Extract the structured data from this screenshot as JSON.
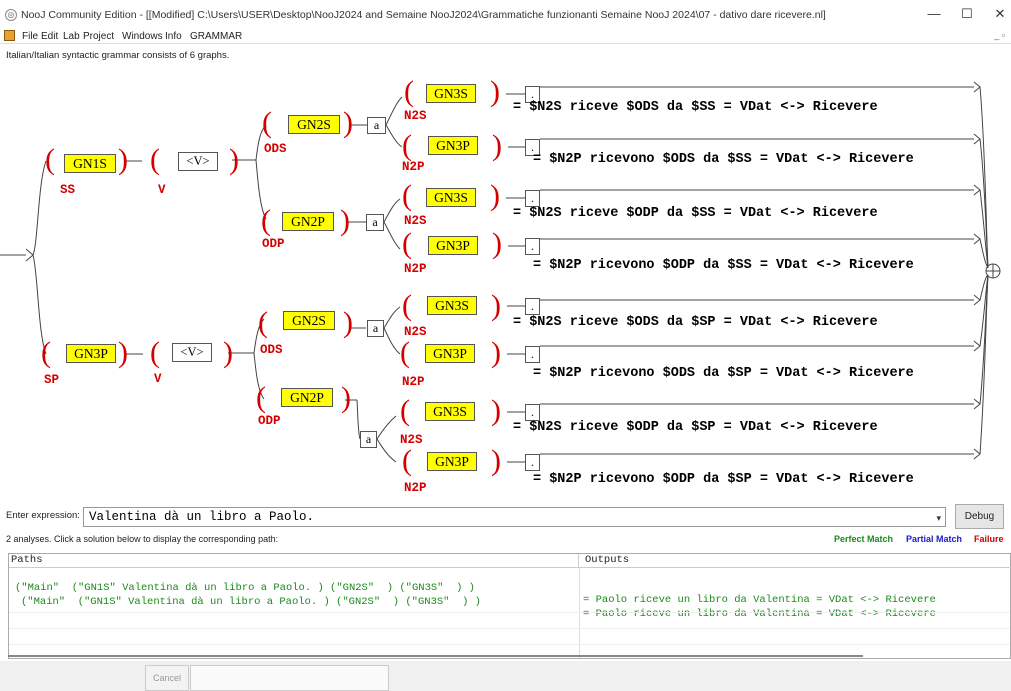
{
  "window": {
    "title": "NooJ Community Edition - [[Modified] C:\\Users\\USER\\Desktop\\NooJ2024 and Semaine NooJ2024\\Grammatiche funzionanti Semaine NooJ 2024\\07 - dativo dare ricevere.nl]",
    "minimize": "—",
    "maximize": "☐",
    "close": "✕"
  },
  "menu": [
    "File",
    "Edit",
    "Lab",
    "Project",
    "Windows",
    "Info",
    "GRAMMAR"
  ],
  "mdi_controls": "_ ▫",
  "grammar_info": "Italian/Italian syntactic grammar consists of 6 graphs.",
  "graph": {
    "nodes": {
      "gn1s": "GN1S",
      "gn3p_top": "GN3P",
      "v1": "<V>",
      "v2": "<V>",
      "gn2s_a": "GN2S",
      "gn2p_a": "GN2P",
      "gn2s_b": "GN2S",
      "gn2p_b": "GN2P",
      "a1": "a",
      "a2": "a",
      "a3": "a",
      "a4": "a",
      "n1": "GN3S",
      "n2": "GN3P",
      "n3": "GN3S",
      "n4": "GN3P",
      "n5": "GN3S",
      "n6": "GN3P",
      "n7": "GN3S",
      "n8": "GN3P",
      "dot": "."
    },
    "var_labels": {
      "ss": "SS",
      "sp": "SP",
      "v1": "V",
      "v2": "V",
      "ods1": "ODS",
      "odp1": "ODP",
      "ods2": "ODS",
      "odp2": "ODP",
      "n1": "N2S",
      "n2": "N2P",
      "n3": "N2S",
      "n4": "N2P",
      "n5": "N2S",
      "n6": "N2P",
      "n7": "N2S",
      "n8": "N2P"
    },
    "paren_open": "(",
    "paren_close": ")",
    "outputs": [
      "= $N2S riceve $ODS da $SS = VDat <-> Ricevere",
      "= $N2P ricevono $ODS da $SS = VDat <-> Ricevere",
      "= $N2S riceve $ODP da $SS = VDat <-> Ricevere",
      "= $N2P ricevono $ODP da $SS = VDat <-> Ricevere",
      "= $N2S riceve $ODS da $SP = VDat <-> Ricevere",
      "= $N2P ricevono $ODS da $SP = VDat <-> Ricevere",
      "= $N2S riceve $ODP da $SP = VDat <-> Ricevere",
      "= $N2P ricevono $ODP da $SP = VDat <-> Ricevere"
    ]
  },
  "expression": {
    "label": "Enter expression:",
    "value": "Valentina dà un libro a Paolo.",
    "dropdown": "▾"
  },
  "debug_label": "Debug",
  "analyses_text": "2 analyses. Click a solution below to display the corresponding path:",
  "legend": {
    "perfect": "Perfect Match",
    "partial": "Partial Match",
    "failure": "Failure",
    "colors": {
      "perfect": "#1a8a1a",
      "partial": "#1a1acc",
      "failure": "#cc0000"
    }
  },
  "results": {
    "paths_header": "Paths",
    "outputs_header": "Outputs",
    "rows": [
      {
        "path": "(\"Main\"  (\"GN1S\" Valentina dà un libro a Paolo. ) (\"GN2S\"  ) (\"GN3S\"  ) )",
        "output": "= Paolo riceve un libro da Valentina = VDat <-> Ricevere"
      },
      {
        "path": "(\"Main\"  (\"GN1S\" Valentina dà un libro a Paolo. ) (\"GN2S\"  ) (\"GN3S\"  ) )",
        "output": "= Paolo riceve un libro da Valentina = VDat <-> Ricevere"
      }
    ]
  },
  "cancel_label": "Cancel"
}
